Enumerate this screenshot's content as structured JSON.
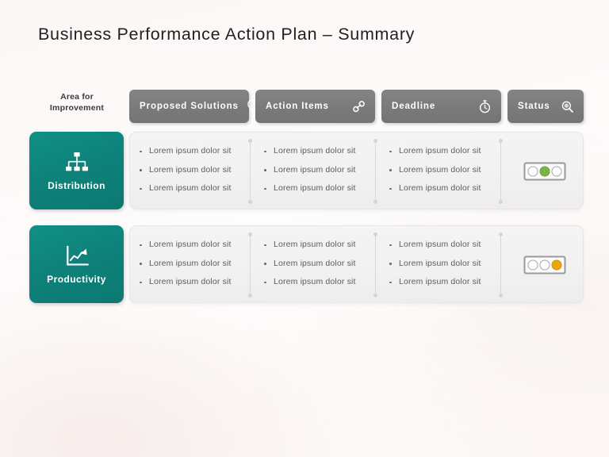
{
  "slide": {
    "title": "Business Performance Action Plan – Summary",
    "area_label_line1": "Area for",
    "area_label_line2": "Improvement",
    "accent_teal": "#0e827a",
    "header_gray": "#7a7a7a",
    "status_green": "#7cb342",
    "status_amber": "#e8a80d",
    "body_text_color": "#5c5c5c",
    "background": "#fdfbfa"
  },
  "headers": [
    {
      "label": "Proposed Solutions",
      "icon": "lightbulb-icon"
    },
    {
      "label": "Action Items",
      "icon": "link-nodes-icon"
    },
    {
      "label": "Deadline",
      "icon": "stopwatch-icon"
    },
    {
      "label": "Status",
      "icon": "search-icon"
    }
  ],
  "rows": [
    {
      "area": {
        "label": "Distribution",
        "icon": "org-chart-icon"
      },
      "solutions": [
        "Lorem ipsum dolor sit",
        "Lorem ipsum dolor sit",
        "Lorem ipsum dolor sit"
      ],
      "actions": [
        "Lorem ipsum dolor sit",
        "Lorem ipsum dolor sit",
        "Lorem ipsum dolor sit"
      ],
      "deadline": [
        "Lorem ipsum dolor sit",
        "Lorem ipsum dolor sit",
        "Lorem ipsum dolor sit"
      ],
      "status": {
        "lamps": [
          "off",
          "green",
          "off"
        ]
      }
    },
    {
      "area": {
        "label": "Productivity",
        "icon": "growth-chart-icon"
      },
      "solutions": [
        "Lorem ipsum dolor sit",
        "Lorem ipsum dolor sit",
        "Lorem ipsum dolor sit"
      ],
      "actions": [
        "Lorem ipsum dolor sit",
        "Lorem ipsum dolor sit",
        "Lorem ipsum dolor sit"
      ],
      "deadline": [
        "Lorem ipsum dolor sit",
        "Lorem ipsum dolor sit",
        "Lorem ipsum dolor sit"
      ],
      "status": {
        "lamps": [
          "off",
          "off",
          "amber"
        ]
      }
    }
  ]
}
